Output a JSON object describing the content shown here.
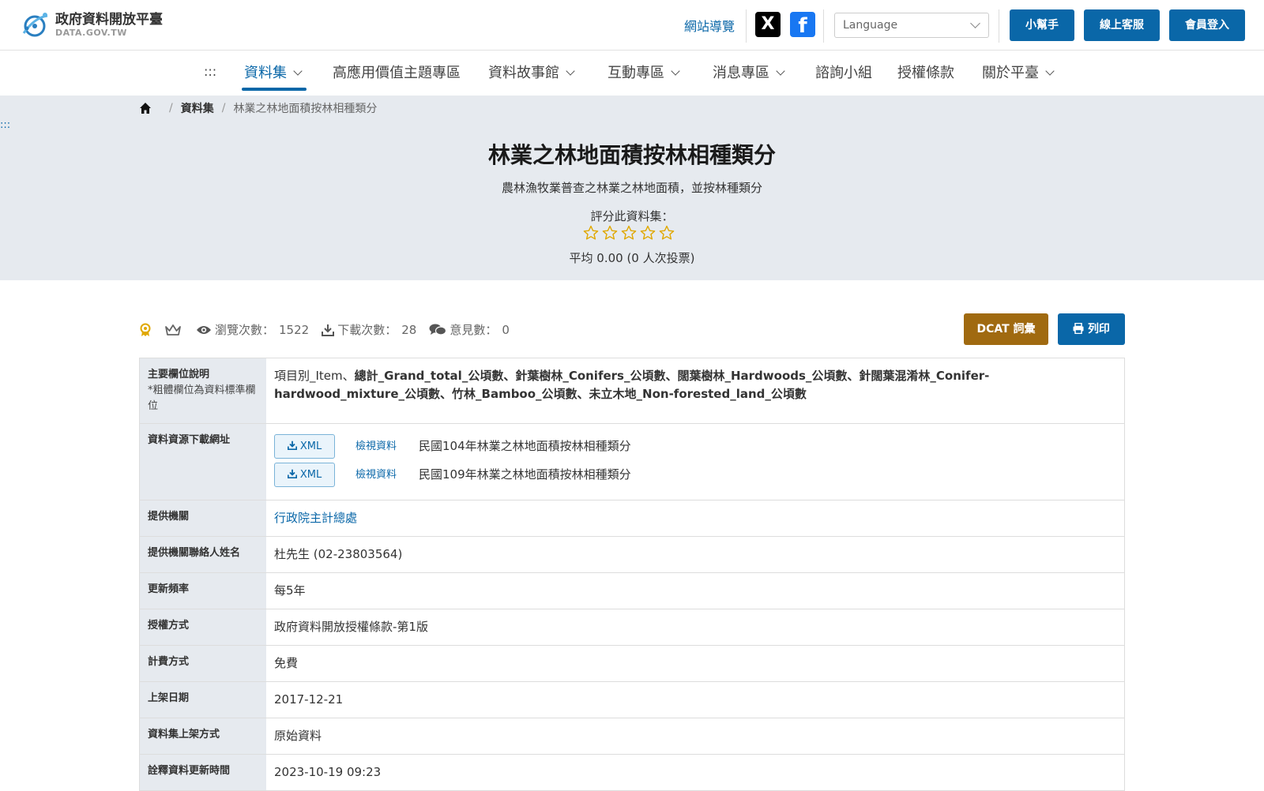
{
  "header": {
    "logo_title": "政府資料開放平臺",
    "logo_sub": "DATA.GOV.TW",
    "sitemap": "網站導覽",
    "x_label": "X",
    "fb_label": "f",
    "language_placeholder": "Language",
    "helper": "小幫手",
    "support": "線上客服",
    "login": "會員登入"
  },
  "nav": {
    "dots": ":::",
    "items": [
      "資料集",
      "高應用價值主題專區",
      "資料故事館",
      "互動專區",
      "消息專區",
      "諮詢小組",
      "授權條款",
      "關於平臺"
    ]
  },
  "breadcrumb": {
    "level1": "資料集",
    "current": "林業之林地面積按林相種類分"
  },
  "side_dots": ":::",
  "dataset": {
    "title": "林業之林地面積按林相種類分",
    "description": "農林漁牧業普查之林業之林地面積，並按林種類分",
    "rate_label": "評分此資料集：",
    "average": "平均 0.00 (0 人次投票)"
  },
  "stats": {
    "views_label": "瀏覽次數：",
    "views": "1522",
    "downloads_label": "下載次數：",
    "downloads": "28",
    "comments_label": "意見數：",
    "comments": "0"
  },
  "actions": {
    "dcat": "DCAT 詞彙",
    "print": "列印"
  },
  "meta": {
    "fields_label": "主要欄位說明",
    "fields_note": "*粗體欄位為資料標準欄位",
    "fields_plain": "項目別_Item、",
    "fields_bold": "總計_Grand_total_公頃數、針葉樹林_Conifers_公頃數、闊葉樹林_Hardwoods_公頃數、針闊葉混淆林_Conifer-hardwood_mixture_公頃數、竹林_Bamboo_公頃數、未立木地_Non-forested_land_公頃數",
    "download_label": "資料資源下載網址",
    "resources": [
      {
        "format": "XML",
        "view": "檢視資料",
        "name": "民國104年林業之林地面積按林相種類分"
      },
      {
        "format": "XML",
        "view": "檢視資料",
        "name": "民國109年林業之林地面積按林相種類分"
      }
    ],
    "rows": [
      {
        "label": "提供機關",
        "value": "行政院主計總處"
      },
      {
        "label": "提供機關聯絡人姓名",
        "value": "杜先生 (02-23803564)"
      },
      {
        "label": "更新頻率",
        "value": "每5年"
      },
      {
        "label": "授權方式",
        "value": "政府資料開放授權條款-第1版"
      },
      {
        "label": "計費方式",
        "value": "免費"
      },
      {
        "label": "上架日期",
        "value": "2017-12-21"
      },
      {
        "label": "資料集上架方式",
        "value": "原始資料"
      },
      {
        "label": "詮釋資料更新時間",
        "value": "2023-10-19 09:23"
      }
    ]
  },
  "colors": {
    "primary": "#0a67a8",
    "dcat": "#a06a10",
    "hero_bg": "#e6eaef",
    "star": "#e0a800"
  }
}
